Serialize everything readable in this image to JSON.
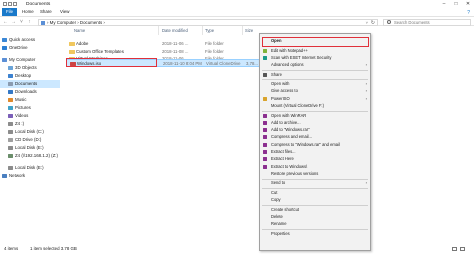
{
  "window": {
    "title": "Documents",
    "controls": [
      "minimize-icon",
      "maximize-icon",
      "close-icon"
    ]
  },
  "ribbon": {
    "tabs": [
      "File",
      "Home",
      "Share",
      "View"
    ]
  },
  "address": {
    "crumbs": "›  My Computer  ›  Documents  ›",
    "search_placeholder": "Search Documents"
  },
  "nav": {
    "items": [
      {
        "label": "Quick access",
        "icon": "star-icon"
      },
      {
        "label": "OneDrive",
        "icon": "cloud-icon"
      },
      {
        "label": "My Computer",
        "icon": "computer-icon"
      },
      {
        "label": "3D Objects",
        "icon": "cube-icon"
      },
      {
        "label": "Desktop",
        "icon": "desktop-icon"
      },
      {
        "label": "Documents",
        "icon": "documents-icon"
      },
      {
        "label": "Downloads",
        "icon": "download-icon"
      },
      {
        "label": "Music",
        "icon": "music-icon"
      },
      {
        "label": "Pictures",
        "icon": "pictures-icon"
      },
      {
        "label": "Videos",
        "icon": "video-icon"
      },
      {
        "label": "Z4 :)",
        "icon": "drive-icon"
      },
      {
        "label": "Local Disk (C:)",
        "icon": "drive-icon"
      },
      {
        "label": "CD Drive (D:)",
        "icon": "cd-icon"
      },
      {
        "label": "Local Disk (E:)",
        "icon": "drive-icon"
      },
      {
        "label": "Z4 (\\\\192.168.1.2) (Z:)",
        "icon": "network-drive-icon"
      },
      {
        "label": "Local Disk (E:)",
        "icon": "drive-icon"
      },
      {
        "label": "Network",
        "icon": "network-icon"
      }
    ]
  },
  "files": {
    "columns": [
      "Name",
      "Date modified",
      "Type",
      "Size"
    ],
    "rows": [
      {
        "name": "Adobe",
        "date": "2018-11-06 ...",
        "type": "File folder",
        "size": "",
        "icon": "folder-icon"
      },
      {
        "name": "Custom Office Templates",
        "date": "2018-11-08 ...",
        "type": "File folder",
        "size": "",
        "icon": "folder-icon"
      },
      {
        "name": "Virtual Machines",
        "date": "2018-11-06 ...",
        "type": "File folder",
        "size": "",
        "icon": "folder-icon"
      },
      {
        "name": "Windows.iso",
        "date": "2018-11-10 8:04 PM",
        "type": "Virtual CloneDrive",
        "size": "3,78...",
        "icon": "disc-image-icon"
      }
    ]
  },
  "status": {
    "items": "4 items",
    "selected": "1 item selected  3.78 GB"
  },
  "context_menu": {
    "items": [
      {
        "label": "Open",
        "icon": "",
        "bold": true,
        "arrow": false
      },
      {
        "label": "Edit with Notepad++",
        "icon": "notepad-icon",
        "arrow": false
      },
      {
        "label": "Scan with ESET Internet Security",
        "icon": "eset-icon",
        "arrow": false
      },
      {
        "label": "Advanced options",
        "icon": "",
        "arrow": true
      },
      {
        "label": "Share",
        "icon": "share-icon",
        "arrow": false
      },
      {
        "label": "Open with",
        "icon": "",
        "arrow": true
      },
      {
        "label": "Give access to",
        "icon": "",
        "arrow": true
      },
      {
        "label": "PowerISO",
        "icon": "poweriso-icon",
        "arrow": true
      },
      {
        "label": "Mount (Virtual CloneDrive F:)",
        "icon": "",
        "arrow": false
      },
      {
        "label": "Open with WinRAR",
        "icon": "winrar-icon",
        "arrow": false
      },
      {
        "label": "Add to archive...",
        "icon": "winrar-icon",
        "arrow": false
      },
      {
        "label": "Add to \"Windows.rar\"",
        "icon": "winrar-icon",
        "arrow": false
      },
      {
        "label": "Compress and email...",
        "icon": "winrar-icon",
        "arrow": false
      },
      {
        "label": "Compress to \"Windows.rar\" and email",
        "icon": "winrar-icon",
        "arrow": false
      },
      {
        "label": "Extract files...",
        "icon": "winrar-icon",
        "arrow": false
      },
      {
        "label": "Extract Here",
        "icon": "winrar-icon",
        "arrow": false
      },
      {
        "label": "Extract to Windows\\",
        "icon": "winrar-icon",
        "arrow": false
      },
      {
        "label": "Restore previous versions",
        "icon": "",
        "arrow": false
      },
      {
        "label": "Send to",
        "icon": "",
        "arrow": true
      },
      {
        "label": "Cut",
        "icon": "",
        "arrow": false
      },
      {
        "label": "Copy",
        "icon": "",
        "arrow": false
      },
      {
        "label": "Create shortcut",
        "icon": "",
        "arrow": false
      },
      {
        "label": "Delete",
        "icon": "",
        "arrow": false
      },
      {
        "label": "Rename",
        "icon": "",
        "arrow": false
      },
      {
        "label": "Properties",
        "icon": "",
        "arrow": false
      }
    ]
  },
  "colors": {
    "accent": "#1979ca",
    "selection": "#cce8ff",
    "highlight_box": "#e0303a",
    "folder": "#f0c75e",
    "winrar": "#8b2f8f"
  }
}
